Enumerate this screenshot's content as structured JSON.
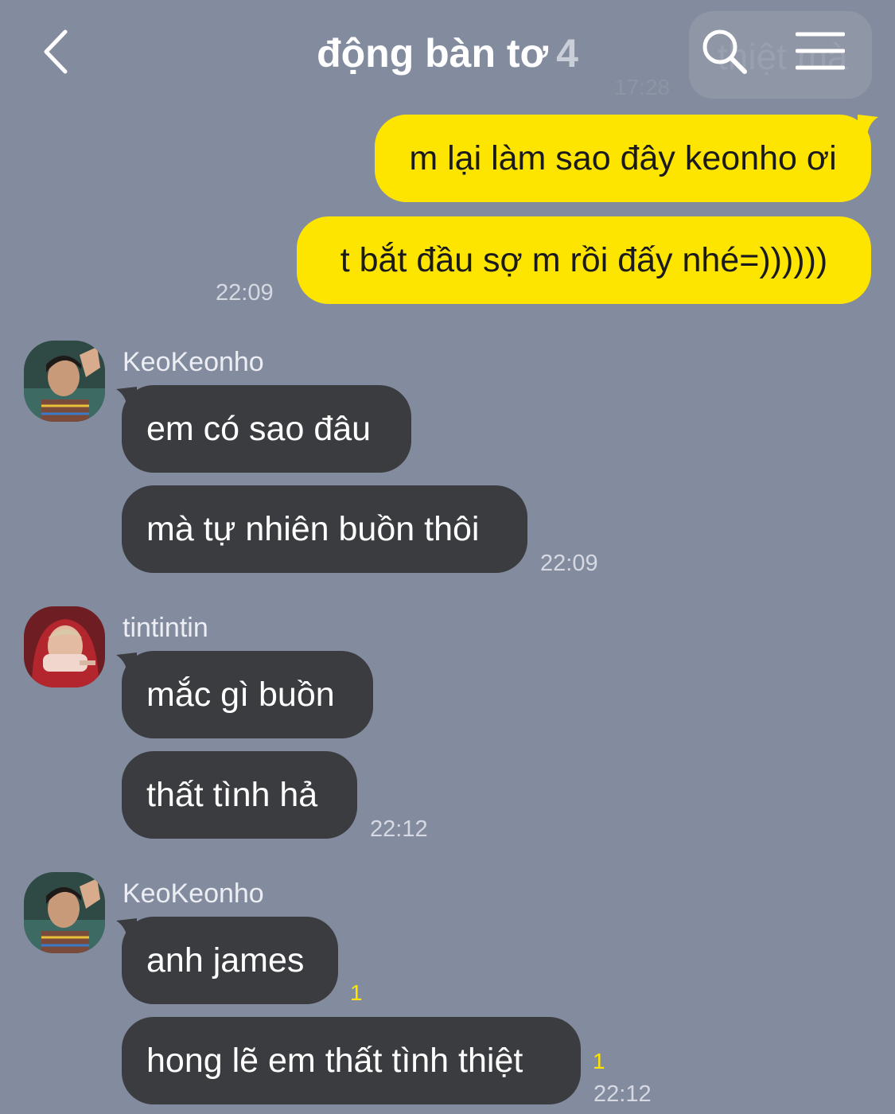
{
  "header": {
    "title": "động bàn tơ",
    "member_count": "4",
    "ghost_text": "thiệt mà",
    "ghost_time": "17:28"
  },
  "messages": {
    "mine": [
      {
        "text": "m lại làm sao đây keonho ơi"
      },
      {
        "text": "t bắt đầu sợ m rồi đấy nhé=))))))"
      }
    ],
    "mine_time": "22:09",
    "group1": {
      "sender": "KeoKeonho",
      "items": [
        {
          "text": "em có sao đâu"
        },
        {
          "text": "mà tự nhiên buồn thôi"
        }
      ],
      "time": "22:09"
    },
    "group2": {
      "sender": "tintintin",
      "items": [
        {
          "text": "mắc gì buồn"
        },
        {
          "text": "thất tình hả"
        }
      ],
      "time": "22:12"
    },
    "group3": {
      "sender": "KeoKeonho",
      "items": [
        {
          "text": "anh james",
          "unread": "1"
        },
        {
          "text": "hong lẽ em thất tình thiệt",
          "unread": "1"
        }
      ],
      "time": "22:12"
    }
  },
  "colors": {
    "background": "#838b9e",
    "my_bubble": "#fee500",
    "their_bubble": "#3b3c40",
    "unread": "#fee500"
  },
  "icons": [
    "back-arrow-icon",
    "search-icon",
    "menu-icon"
  ]
}
